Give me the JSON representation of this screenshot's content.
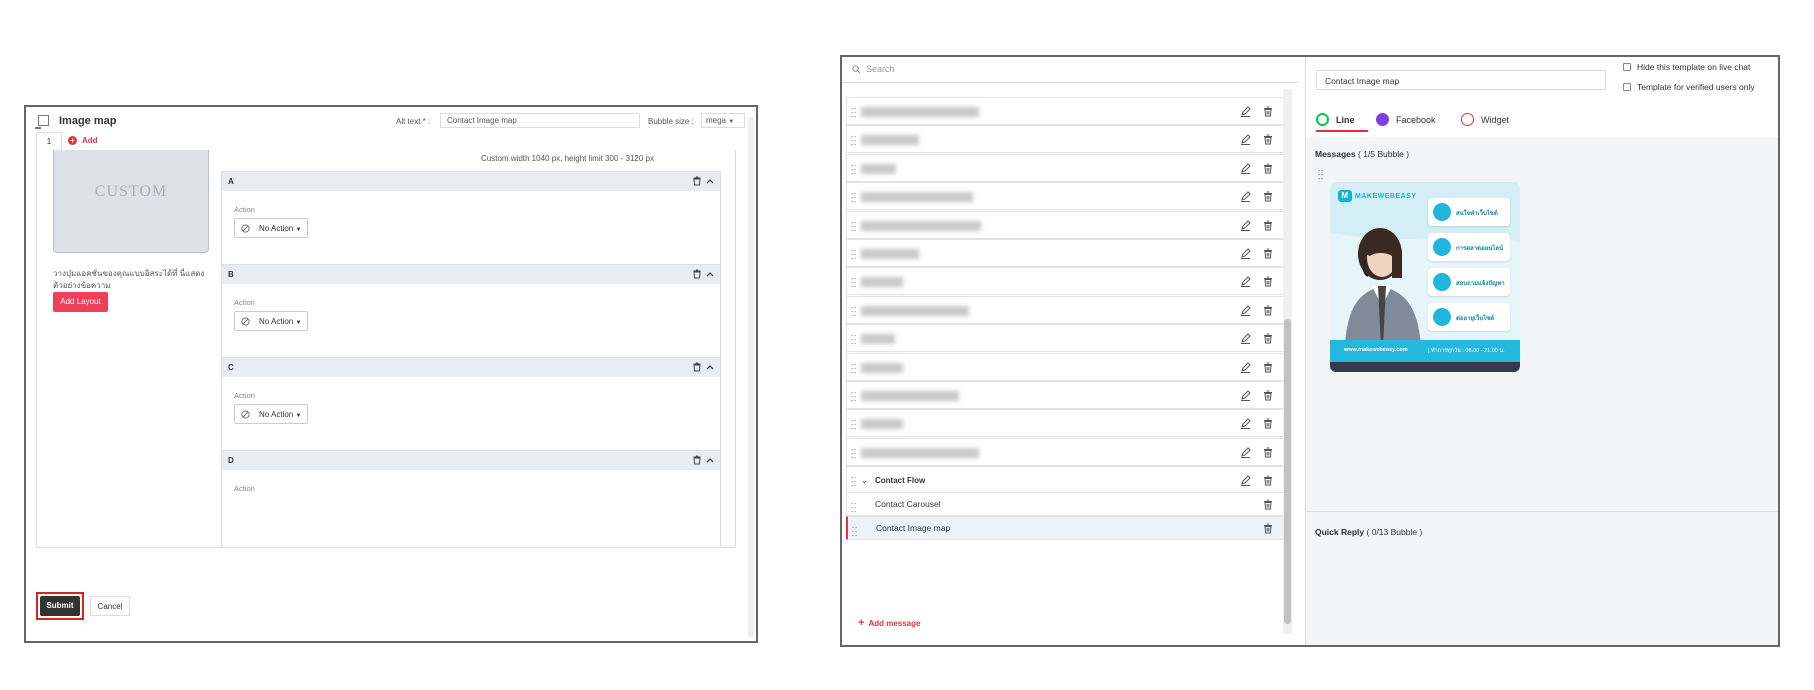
{
  "editor": {
    "title": "Image map",
    "alt_text_label": "Alt text * :",
    "alt_text_value": "Contact Image map",
    "bubble_size_label": "Bubble size :",
    "bubble_size_value": "mega",
    "tab_number": "1",
    "add_tab": "Add",
    "preview_text": "CUSTOM",
    "note": "วางปุ่มแอคชั่นของคุณแบบอิสระได้ที่ นี่แสดงตัวอย่างข้อความ",
    "add_layout": "Add Layout",
    "custom_note": "Custom width 1040 px, height limit 300 - 3120 px",
    "action_label": "Action",
    "no_action": "No Action",
    "sections": [
      "A",
      "B",
      "C",
      "D"
    ],
    "submit": "Submit",
    "cancel": "Cancel"
  },
  "flow": {
    "search_placeholder": "Search",
    "group_label": "Contact Flow",
    "items": [
      {
        "label": "Contact Carousel"
      },
      {
        "label": "Contact Image map"
      }
    ],
    "add_message": "Add message"
  },
  "template": {
    "name_value": "Contact Image map",
    "hide_live_chat": "Hide this template on live chat",
    "verified_only": "Template for verified users only",
    "tabs": [
      "Line",
      "Facebook",
      "Widget"
    ],
    "messages_label": "Messages",
    "messages_count": "( 1/5 Bubble )",
    "quick_reply_label": "Quick Reply",
    "quick_reply_count": "( 0/13 Bubble )",
    "card": {
      "brand": "MAKEWEBEASY",
      "buttons": [
        "สนใจทำเว็บไซต์",
        "การตลาดออนไลน์",
        "สอบถามแจ้งปัญหา",
        "ต่ออายุเว็บไซต์"
      ],
      "footer_left": "www.makewebeasy.com",
      "footer_right": "| ทำการทุกวัน : 08.00 - 21.00 น."
    }
  },
  "colors": {
    "accent": "#e0333f",
    "submit": "#333333",
    "line": "#06c755",
    "facebook": "#7b3fe4"
  }
}
